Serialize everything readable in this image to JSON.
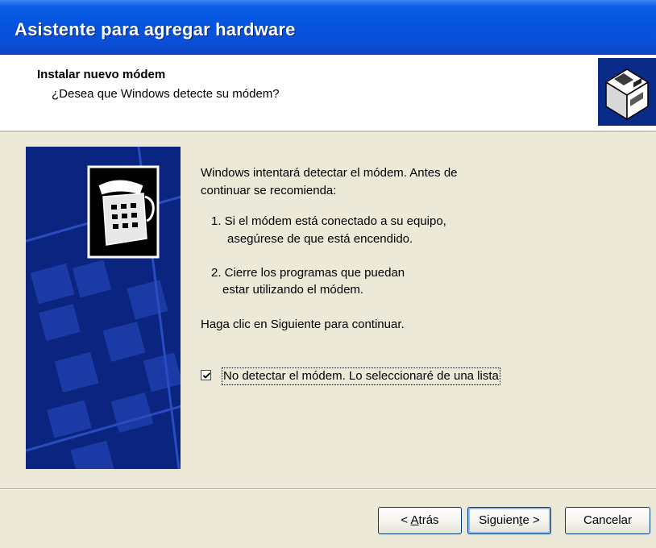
{
  "window": {
    "title": "Asistente para agregar hardware"
  },
  "header": {
    "title": "Instalar nuevo módem",
    "subtitle": "¿Desea que Windows detecte su módem?",
    "icon": "hardware-box-icon"
  },
  "banner": {
    "icon": "telephone-modem-icon"
  },
  "content": {
    "intro_line1": "Windows intentará detectar el módem. Antes de",
    "intro_line2": "continuar se recomienda:",
    "step1_line1": "1.  Si el módem está conectado a su equipo,",
    "step1_line2": "asegúrese de que está encendido.",
    "step2_line1": "2.  Cierre los programas que puedan",
    "step2_line2": "estar utilizando el módem.",
    "instruction": "Haga clic en Siguiente para continuar."
  },
  "checkbox": {
    "label": "No detectar el módem. Lo seleccionaré de una lista",
    "checked": true
  },
  "buttons": {
    "back_pre": "< ",
    "back_accel": "A",
    "back_post": "trás",
    "next_pre": "Siguien",
    "next_accel": "t",
    "next_post": "e >",
    "cancel": "Cancelar"
  },
  "colors": {
    "titlebar": "#0553df",
    "dialog_bg": "#ece9d8",
    "banner_bg": "#0b2480",
    "button_border": "#003c74"
  }
}
